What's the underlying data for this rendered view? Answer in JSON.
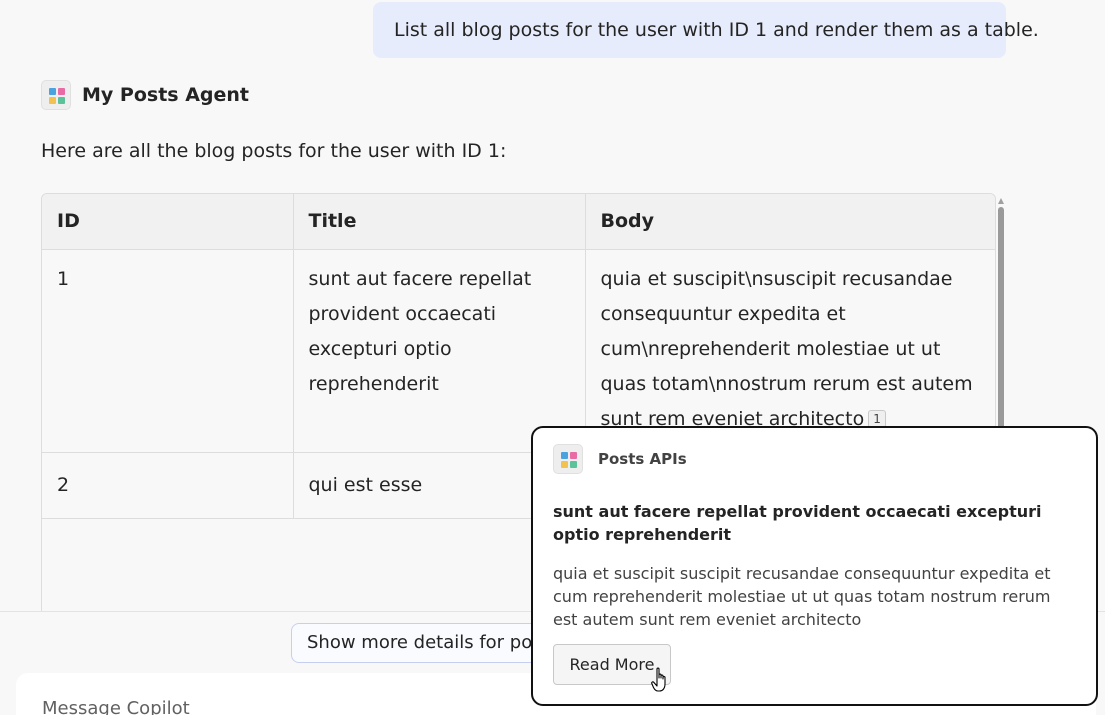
{
  "user_message": "List all blog posts for the user with ID 1 and render them as a table.",
  "agent": {
    "name": "My Posts Agent",
    "intro": "Here are all the blog posts for the user with ID 1:",
    "icon": "apps-grid-icon"
  },
  "table": {
    "headers": [
      "ID",
      "Title",
      "Body"
    ],
    "rows": [
      {
        "id": "1",
        "title": "sunt aut facere repellat provident occaecati excepturi optio reprehenderit",
        "body": "quia et suscipit\\nsuscipit recusandae consequuntur expedita et cum\\nreprehenderit molestiae ut ut quas totam\\nnostrum rerum est autem sunt rem eveniet architecto",
        "citation": "1"
      },
      {
        "id": "2",
        "title": "qui est esse",
        "body": ""
      }
    ]
  },
  "suggestion": "Show more details for post ID",
  "composer": {
    "placeholder": "Message Copilot"
  },
  "citation_card": {
    "source": "Posts APIs",
    "title": "sunt aut facere repellat provident occaecati excepturi optio reprehenderit",
    "body": "quia et suscipit suscipit recusandae consequuntur expedita et cum reprehenderit molestiae ut ut quas totam nostrum rerum est autem sunt rem eveniet architecto",
    "button": "Read More"
  },
  "colors": {
    "user_bubble": "#e7ecfc",
    "tile_blue": "#4aa3df",
    "tile_pink": "#e86ba5",
    "tile_yellow": "#f2c14e",
    "tile_green": "#5cc29a"
  }
}
